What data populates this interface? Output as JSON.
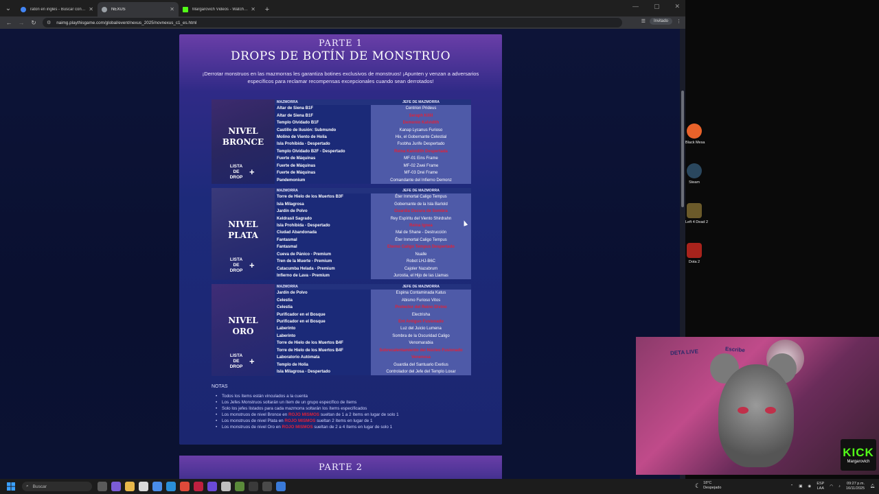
{
  "browser": {
    "tabs": [
      {
        "title": "raton en ingles - Buscar con Go",
        "color": "#4285f4"
      },
      {
        "title": "NEXUS",
        "color": "#9aa0a6"
      },
      {
        "title": "Margarovich Videos - Watch Cl",
        "color": "#53fc18"
      }
    ],
    "url": "naimg.playthisgame.com/global/event/nexus_2025/novnexus_c1_es.html",
    "guest_label": "Invitado"
  },
  "page": {
    "part1": "PARTE 1",
    "title": "DROPS DE BOTÍN DE MONSTRUO",
    "intro": "¡Derrotar monstruos en las mazmorras les garantiza botines exclusivos de monstruos! ¡Apunten y venzan a adversarios específicos para reclamar recompensas excepcionales cuando sean derrotados!",
    "col_dungeon": "MAZMORRA",
    "col_boss": "JEFE DE MAZMORRA",
    "drop_list": "LISTA DE DROP",
    "tiers": [
      {
        "name_l1": "NIVEL",
        "name_l2": "BRONCE",
        "rows": [
          {
            "d": "Altar de Siena B1F",
            "b": "Centrion Prideus",
            "red": false
          },
          {
            "d": "Altar de Siena B1F",
            "b": "Seraph Killil",
            "red": true
          },
          {
            "d": "Templo Olvidado B1F",
            "b": "Demonio Kalvidith",
            "red": true
          },
          {
            "d": "Castillo de Ilusión: Submundo",
            "b": "Kanap Lycanus Furioso",
            "red": false
          },
          {
            "d": "Molino de Viento de Holia",
            "b": "Hix, el Gobernante Celestial",
            "red": false
          },
          {
            "d": "Isla Prohibida - Despertado",
            "b": "Fsobha Jurife Despertado",
            "red": false
          },
          {
            "d": "Templo Olvidado B2F - Despertado",
            "b": "Reina Kalvidith Despertada",
            "red": true
          },
          {
            "d": "Fuerte de Máquinas",
            "b": "MF-01 Eins Frame",
            "red": false
          },
          {
            "d": "Fuerte de Máquinas",
            "b": "MF-02 Zwei Frame",
            "red": false
          },
          {
            "d": "Fuerte de Máquinas",
            "b": "MF-03 Drei Frame",
            "red": false
          },
          {
            "d": "Pandemonium",
            "b": "Comandante del Infierno Demonz",
            "red": false
          }
        ]
      },
      {
        "name_l1": "NIVEL",
        "name_l2": "PLATA",
        "rows": [
          {
            "d": "Torre de Hielo de los Muertos B3F",
            "b": "Éter Inmortal Caligo Tempus",
            "red": false
          },
          {
            "d": "Isla Milagrosa",
            "b": "Gobernante de la Isla Barlold",
            "red": false
          },
          {
            "d": "Jardín de Polvo",
            "b": "Guardia Oscura de Sombra",
            "red": true
          },
          {
            "d": "Keldrasil Sagrado",
            "b": "Rey Espíritu del Viento Shirdrahn",
            "red": false
          },
          {
            "d": "Isla Prohibida - Despertado",
            "b": "Reina Ignea",
            "red": true
          },
          {
            "d": "Ciudad Abandonada",
            "b": "Mal de Shane - Destrucción",
            "red": false
          },
          {
            "d": "Fantasmal",
            "b": "Éter Inmortal Caligo Tempus",
            "red": false
          },
          {
            "d": "Fantasmal",
            "b": "Eterno Caligo Tempus Despertado",
            "red": true
          },
          {
            "d": "Cueva de Pánico - Premium",
            "b": "Nualle",
            "red": false
          },
          {
            "d": "Tren de la Muerte - Premium",
            "b": "Robot LHJ-B6C",
            "red": false
          },
          {
            "d": "Catacumba Helada - Premium",
            "b": "Cajoler Nazabrum",
            "red": false
          },
          {
            "d": "Infierno de Lava - Premium",
            "b": "Jurostia, el Hijo de las Llamas",
            "red": false
          }
        ]
      },
      {
        "name_l1": "NIVEL",
        "name_l2": "ORO",
        "rows": [
          {
            "d": "Jardín de Polvo",
            "b": "Espina Contaminada Katus",
            "red": false
          },
          {
            "d": "Celestia",
            "b": "Abismo Furioso Vitos",
            "red": false
          },
          {
            "d": "Celestia",
            "b": "Protector del Reino Divino",
            "red": true
          },
          {
            "d": "Purificador en el Bosque",
            "b": "Electrisha",
            "red": false
          },
          {
            "d": "Purificador en el Bosque",
            "b": "Ent Antiguo Fusionado",
            "red": true
          },
          {
            "d": "Laberinto",
            "b": "Luz del Juicio Lumena",
            "red": false
          },
          {
            "d": "Laberinto",
            "b": "Sombra de la Oscuridad Caligo",
            "red": false
          },
          {
            "d": "Torre de Hielo de los Muertos B4F",
            "b": "Venomarabia",
            "red": false
          },
          {
            "d": "Torre de Hielo de los Muertos B4F",
            "b": "Sobrecalentamiento del Núcleo Fusionado",
            "red": true
          },
          {
            "d": "Laboratorio Autómata",
            "b": "Venenosa",
            "red": true
          },
          {
            "d": "Templo de Holia",
            "b": "Guardia del Santuario Exetius",
            "red": false
          },
          {
            "d": "Isla Milagrosa - Despertado",
            "b": "Controlador del Jefe del Templo Loxar",
            "red": false
          }
        ]
      }
    ],
    "notes_title": "NOTAS",
    "notes": [
      {
        "pre": "Todos los ítems están vinculados a la cuenta",
        "red": "",
        "post": ""
      },
      {
        "pre": "Los Jefes Monstruos soltarán un ítem de un grupo específico de ítems",
        "red": "",
        "post": ""
      },
      {
        "pre": "Solo los jefes listados para cada mazmorra soltarán los ítems especificados",
        "red": "",
        "post": ""
      },
      {
        "pre": "Los monstruos de nivel Bronce en ",
        "red": "ROJO MISMOS",
        "post": " sueltan de 1 a 2 ítems en lugar de solo 1"
      },
      {
        "pre": "Los monstruos de nivel Plata en ",
        "red": "ROJO MISMOS",
        "post": " sueltan 2 ítems en lugar de 1"
      },
      {
        "pre": "Los monstruos de nivel Oro en ",
        "red": "ROJO MISMOS",
        "post": " sueltan de 2 a 4 ítems en lugar de solo 1"
      }
    ],
    "part2": "PARTE 2"
  },
  "desktop": {
    "icons": [
      {
        "label": "Black Mesa",
        "color": "#e8622a"
      },
      {
        "label": "Steam",
        "color": "#2a475e"
      },
      {
        "label": "Left 4 Dead 2",
        "color": "#6b5a2a"
      },
      {
        "label": "Dota 2",
        "color": "#a8231c"
      }
    ]
  },
  "stream": {
    "sign1": "DETA LIVE",
    "sign2": "Escribe",
    "kick_logo": "KICK",
    "kick_user": "Margarovich"
  },
  "taskbar": {
    "search": "Buscar",
    "weather_temp": "18°C",
    "weather_desc": "Despejado",
    "lang_1": "ESP",
    "lang_2": "LAA",
    "time": "09:27 p.m.",
    "date": "16/11/2025"
  }
}
